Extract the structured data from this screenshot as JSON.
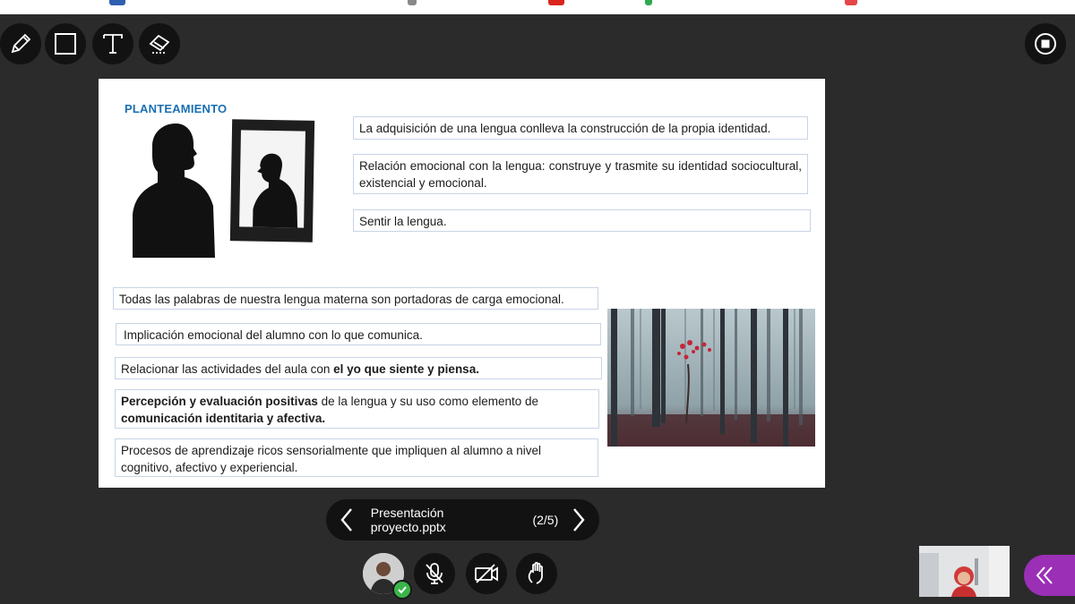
{
  "slide": {
    "title": "PLANTEAMIENTO",
    "box1": "La adquisición de una lengua conlleva la construcción de la propia identidad.",
    "box2": "Relación emocional con la lengua: construye y trasmite su identidad sociocultural, existencial y emocional.",
    "box3": "Sentir la lengua.",
    "box4": "Todas las palabras de nuestra lengua materna son portadoras de carga emocional.",
    "box5": "Implicación emocional del alumno con lo que comunica.",
    "box6": {
      "plain": "Relacionar las actividades del aula con ",
      "bold": "el yo que siente y piensa."
    },
    "box7": {
      "bold1": "Percepción y evaluación positivas",
      "plain": " de la lengua y su uso como elemento de ",
      "bold2": "comunicación identitaria y afectiva."
    },
    "box8": "Procesos de aprendizaje ricos sensorialmente que impliquen al alumno a nivel cognitivo, afectivo y experiencial."
  },
  "navigator": {
    "filename": "Presentación proyecto.pptx",
    "counter": "(2/5)"
  },
  "icons": {
    "tools": [
      "pencil-icon",
      "rectangle-icon",
      "text-icon",
      "eraser-icon"
    ],
    "stop": "stop-presenting-icon",
    "controls": [
      "microphone-muted-icon",
      "camera-off-icon",
      "raise-hand-icon"
    ],
    "expand": "double-chevron-left-icon"
  },
  "colors": {
    "background": "#2b2b2b",
    "toolbar_button": "#121212",
    "slide_title": "#1a6fb3",
    "box_border": "#c8d4e6",
    "expand_button": "#9b2fb5",
    "status_ok": "#3ab54a"
  }
}
